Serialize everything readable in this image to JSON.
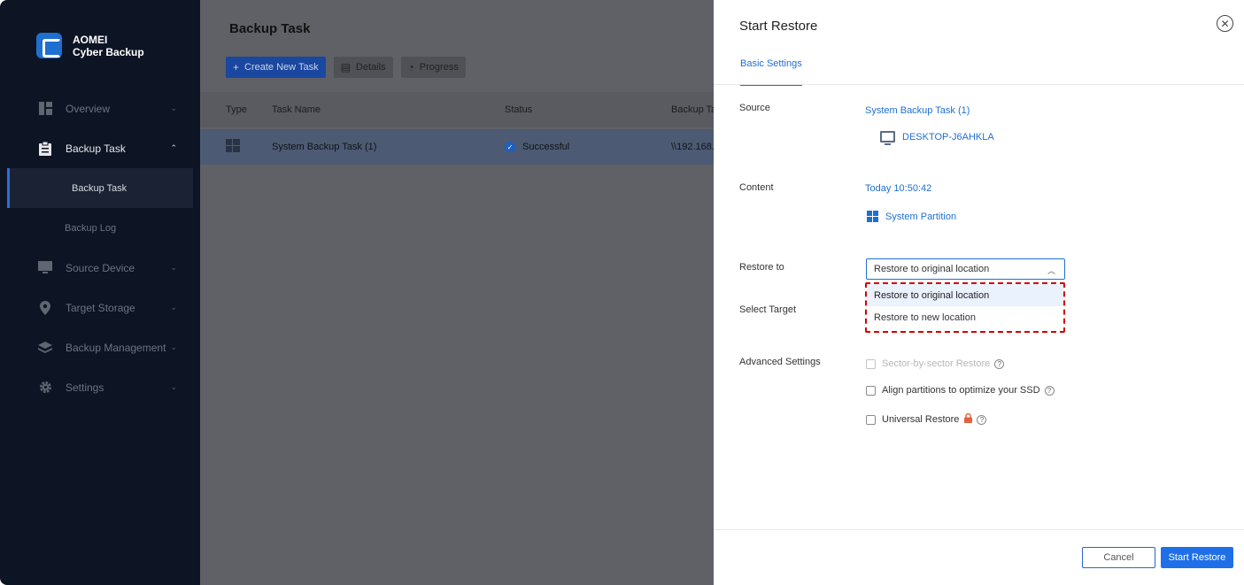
{
  "app": {
    "logo_line1": "AOMEI",
    "logo_line2": "Cyber Backup"
  },
  "sidebar": {
    "items": [
      {
        "label": "Overview",
        "icon": "dashboard-icon",
        "chevron": "⌄"
      },
      {
        "label": "Backup Task",
        "icon": "clipboard-icon",
        "chevron": "⌃"
      },
      {
        "label": "Source Device",
        "icon": "monitor-icon",
        "chevron": "⌄"
      },
      {
        "label": "Target Storage",
        "icon": "location-pin-icon",
        "chevron": "⌄"
      },
      {
        "label": "Backup Management",
        "icon": "layers-icon",
        "chevron": "⌄"
      },
      {
        "label": "Settings",
        "icon": "gear-icon",
        "chevron": "⌄"
      }
    ],
    "sub_items": [
      {
        "label": "Backup Task",
        "active": true
      },
      {
        "label": "Backup Log",
        "active": false
      }
    ]
  },
  "main": {
    "title": "Backup Task",
    "toolbar": {
      "create_label": "Create New Task",
      "details_label": "Details",
      "progress_label": "Progress"
    },
    "columns": [
      "Type",
      "Task Name",
      "Status",
      "Backup Ta"
    ],
    "rows": [
      {
        "name": "System Backup Task (1)",
        "status": "Successful",
        "target": "\\\\192.168."
      }
    ]
  },
  "drawer": {
    "title": "Start Restore",
    "tab": "Basic Settings",
    "source_label": "Source",
    "source_task": "System Backup Task (1)",
    "source_device": "DESKTOP-J6AHKLA",
    "content_label": "Content",
    "content_time": "Today 10:50:42",
    "content_item": "System Partition",
    "restore_to_label": "Restore to",
    "restore_to_value": "Restore to original location",
    "restore_options": [
      "Restore to original location",
      "Restore to new location"
    ],
    "select_target_label": "Select Target",
    "advanced_label": "Advanced Settings",
    "options": {
      "sector": "Sector-by-sector Restore",
      "align": "Align partitions to optimize your SSD",
      "universal": "Universal Restore"
    },
    "cancel_label": "Cancel",
    "start_label": "Start Restore"
  },
  "colors": {
    "accent": "#1f6fd1",
    "sidebar_bg": "#0d1424",
    "highlight_border": "#d40000"
  }
}
